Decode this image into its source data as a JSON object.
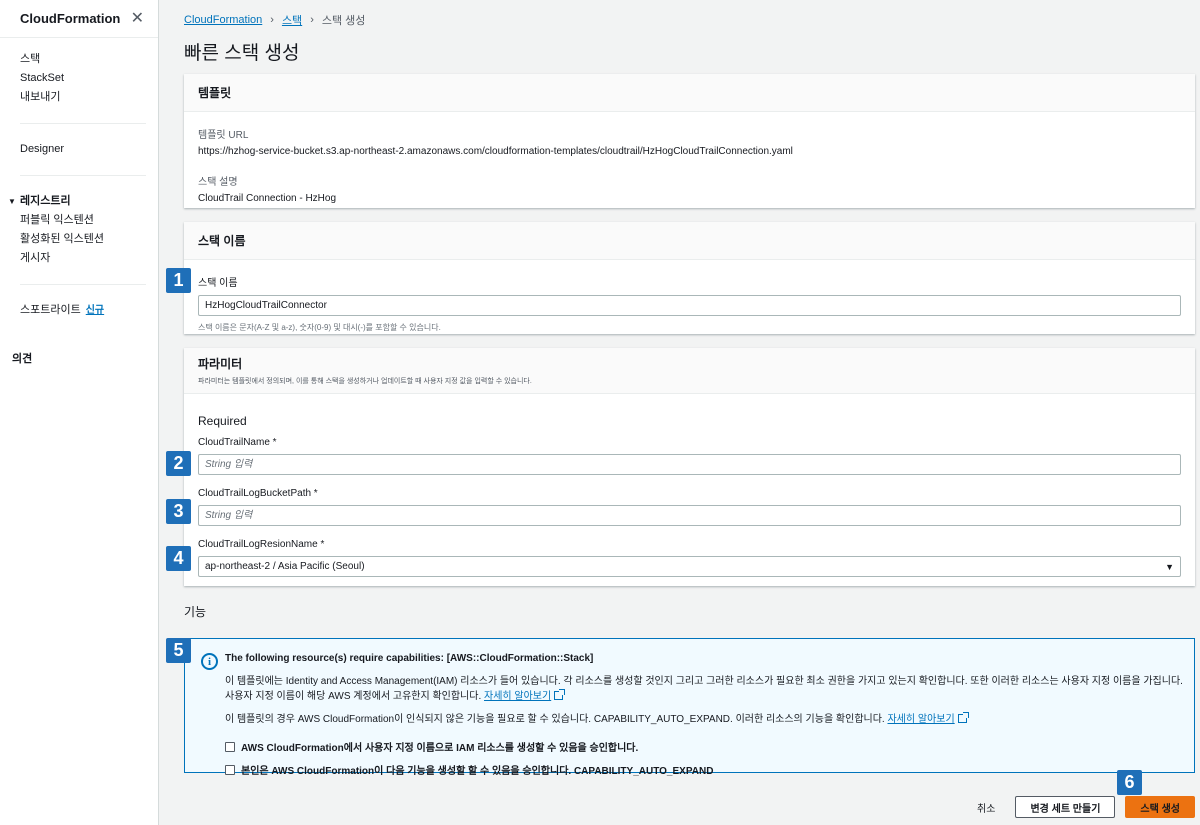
{
  "sidebar": {
    "title": "CloudFormation",
    "items_top": [
      "스택",
      "StackSet",
      "내보내기"
    ],
    "designer": "Designer",
    "registry": {
      "label": "레지스트리",
      "items": [
        "퍼블릭 익스텐션",
        "활성화된 익스텐션",
        "게시자"
      ]
    },
    "spotlight": "스포트라이트",
    "spotlight_new": "신규",
    "feedback": "의견"
  },
  "breadcrumb": {
    "items": [
      "CloudFormation",
      "스택"
    ],
    "current": "스택 생성"
  },
  "page_title": "빠른 스택 생성",
  "template_panel": {
    "title": "템플릿",
    "url_label": "템플릿 URL",
    "url_value": "https://hzhog-service-bucket.s3.ap-northeast-2.amazonaws.com/cloudformation-templates/cloudtrail/HzHogCloudTrailConnection.yaml",
    "desc_label": "스택 설명",
    "desc_value": "CloudTrail Connection - HzHog"
  },
  "stackname_panel": {
    "title": "스택 이름",
    "field_label": "스택 이름",
    "value": "HzHogCloudTrailConnector",
    "hint": "스택 이름은 문자(A-Z 및 a-z), 숫자(0-9) 및 대시(-)를 포함할 수 있습니다."
  },
  "params_panel": {
    "title": "파라미터",
    "description": "파라미터는 템플릿에서 정의되며, 이를 통해 스택을 생성하거나 업데이트할 때 사용자 지정 값을 입력할 수 있습니다.",
    "required_label": "Required",
    "trail_name_label": "CloudTrailName *",
    "trail_name_placeholder": "String 입력",
    "bucket_path_label": "CloudTrailLogBucketPath *",
    "bucket_path_placeholder": "String 입력",
    "region_label": "CloudTrailLogResionName *",
    "region_value": "ap-northeast-2 / Asia Pacific (Seoul)"
  },
  "capabilities": {
    "title": "기능",
    "heading": "The following resource(s) require capabilities: [AWS::CloudFormation::Stack]",
    "text1": "이 템플릿에는 Identity and Access Management(IAM) 리소스가 들어 있습니다. 각 리소스를 생성할 것인지 그리고 그러한 리소스가 필요한 최소 권한을 가지고 있는지 확인합니다. 또한 이러한 리소스는 사용자 지정 이름을 가집니다. 사용자 지정 이름이 해당 AWS 계정에서 고유한지 확인합니다.",
    "text2": "이 템플릿의 경우 AWS CloudFormation이 인식되지 않은 기능을 필요로 할 수 있습니다. CAPABILITY_AUTO_EXPAND. 이러한 리소스의 기능을 확인합니다.",
    "learn_more": "자세히 알아보기",
    "check1": "AWS CloudFormation에서 사용자 지정 이름으로 IAM 리소스를 생성할 수 있음을 승인합니다.",
    "check2": "본인은 AWS CloudFormation이 다음 기능을 생성할 할 수 있음을 승인합니다. CAPABILITY_AUTO_EXPAND"
  },
  "footer": {
    "cancel": "취소",
    "changeset": "변경 세트 만들기",
    "create": "스택 생성"
  },
  "badges": [
    "1",
    "2",
    "3",
    "4",
    "5",
    "6"
  ],
  "colors": {
    "link": "#0073bb",
    "primary_button": "#ec7211",
    "badge": "#1f6fb8",
    "info_bg": "#f1faff"
  }
}
